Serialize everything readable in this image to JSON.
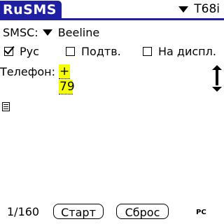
{
  "app": {
    "title": "RuSMS",
    "model_selector": {
      "value": "T68i",
      "icon": "triangle-down-icon"
    },
    "accent_color": "#1f1fa3"
  },
  "smsc": {
    "label": "SMSC:",
    "selected": "Beeline",
    "icon": "triangle-down-icon"
  },
  "options": [
    {
      "label": "Рус",
      "checked": true
    },
    {
      "label": "Подтв.",
      "checked": false
    },
    {
      "label": "На диспл.",
      "checked": false
    }
  ],
  "phone": {
    "label": "Телефон:",
    "lines": [
      "+",
      "79"
    ],
    "highlight_color": "#f6ff00"
  },
  "bottom": {
    "counter": "1/160",
    "start_label": "Старт",
    "reset_label": "Сброс",
    "mode": "PC"
  }
}
